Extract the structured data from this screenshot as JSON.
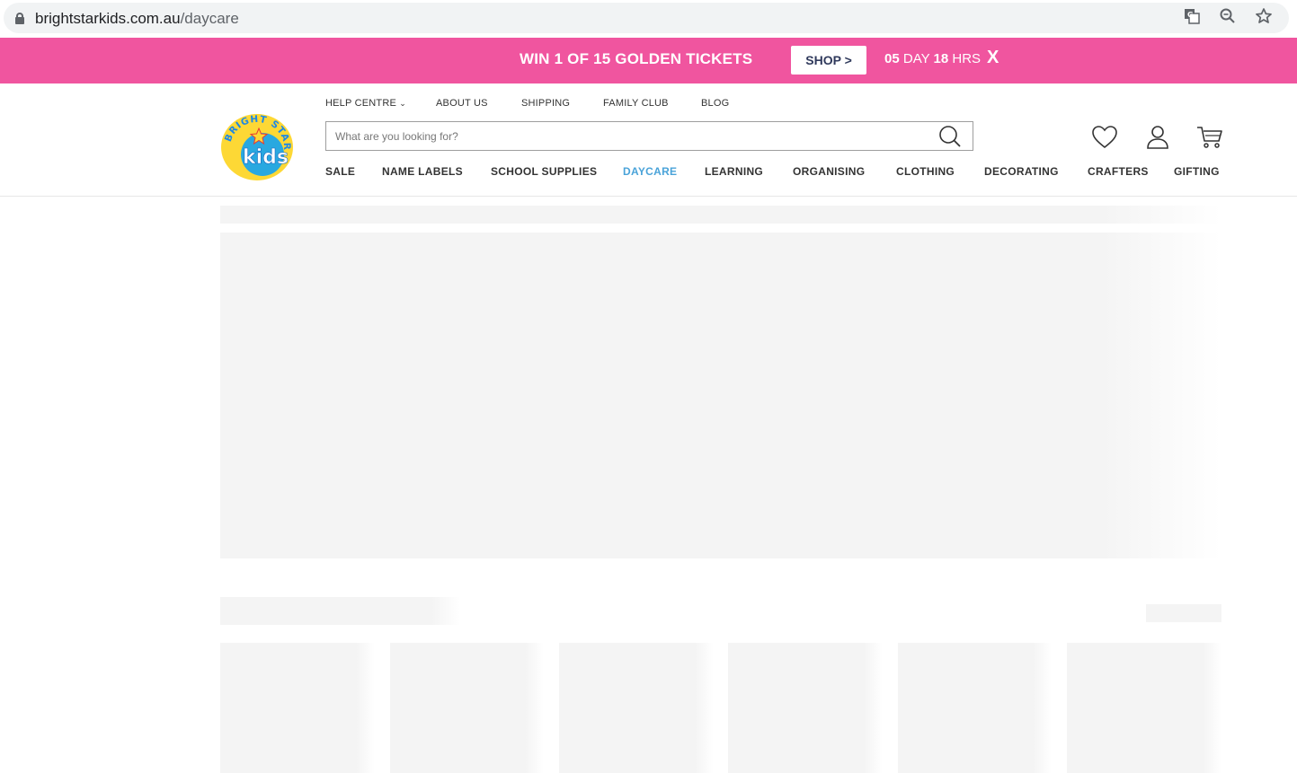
{
  "browser": {
    "url_domain": "brightstarkids.com.au",
    "url_path": "/daycare"
  },
  "promo": {
    "headline": "WIN 1 OF 15 GOLDEN TICKETS",
    "shop_label": "SHOP >",
    "days_value": "05",
    "days_unit": "DAY",
    "hours_value": "18",
    "hours_unit": "HRS",
    "close_label": "X",
    "background_color": "#f0559f"
  },
  "header": {
    "logo_top": "BRIGHT STAR",
    "logo_main": "kids",
    "top_nav": [
      "HELP CENTRE",
      "ABOUT US",
      "SHIPPING",
      "FAMILY CLUB",
      "BLOG"
    ],
    "search_placeholder": "What are you looking for?",
    "main_nav": [
      "SALE",
      "NAME LABELS",
      "SCHOOL SUPPLIES",
      "DAYCARE",
      "LEARNING",
      "ORGANISING",
      "CLOTHING",
      "DECORATING",
      "CRAFTERS",
      "GIFTING"
    ],
    "active_nav": "DAYCARE",
    "active_color": "#4aa3d9",
    "icons": [
      "heart-icon",
      "user-icon",
      "cart-icon"
    ]
  }
}
